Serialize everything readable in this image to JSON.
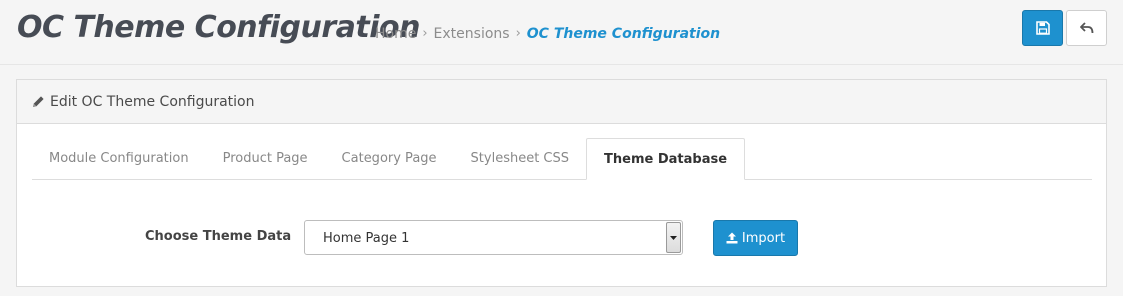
{
  "header": {
    "title": "OC Theme Configuration",
    "breadcrumb": [
      "Home",
      "Extensions",
      "OC Theme Configuration"
    ],
    "save_icon": "floppy-disk-icon",
    "back_icon": "reply-arrow-icon"
  },
  "panel": {
    "heading": "Edit OC Theme Configuration",
    "heading_icon": "pencil-icon"
  },
  "tabs": [
    {
      "label": "Module Configuration",
      "active": false
    },
    {
      "label": "Product Page",
      "active": false
    },
    {
      "label": "Category Page",
      "active": false
    },
    {
      "label": "Stylesheet CSS",
      "active": false
    },
    {
      "label": "Theme Database",
      "active": true
    }
  ],
  "form": {
    "label": "Choose Theme Data",
    "selected": "Home Page 1",
    "import_label": "Import",
    "import_icon": "upload-icon"
  },
  "colors": {
    "primary": "#1e91cf",
    "title": "#474c55"
  }
}
